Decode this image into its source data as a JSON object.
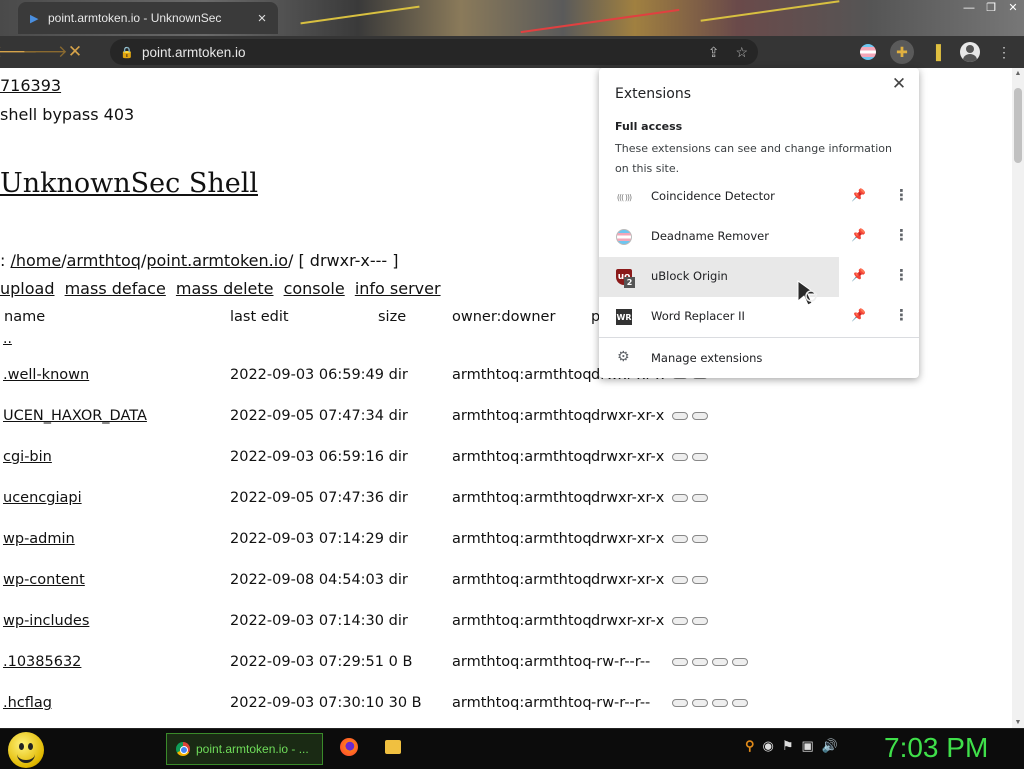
{
  "browser": {
    "tab_title": "point.armtoken.io - UnknownSec",
    "url": "point.armtoken.io",
    "accent_color": "#d6a34a"
  },
  "page": {
    "line1": "716393",
    "line2": "shell bypass 403",
    "title": "UnknownSec Shell",
    "path": {
      "prefix": ":",
      "seg1": "/home",
      "sep1": "/",
      "seg2": "armthtoq",
      "sep2": "/",
      "seg3": "point.armtoken.io",
      "sep3": "/",
      "perm": "[ drwxr-x--- ]"
    },
    "actions": [
      "upload",
      "mass deface",
      "mass delete",
      "console",
      "info server"
    ],
    "columns": {
      "name": "name",
      "last_edit": "last edit",
      "size": "size",
      "owner": "owner:downer",
      "perm": "p"
    },
    "updir": "..",
    "files": [
      {
        "name": ".well-known",
        "date": "2022-09-03 06:59:49",
        "size": "dir",
        "owner": "armthtoq:armthtoq",
        "perm": "drwxr-xr-x",
        "pills": 2
      },
      {
        "name": "UCEN_HAXOR_DATA",
        "date": "2022-09-05 07:47:34",
        "size": "dir",
        "owner": "armthtoq:armthtoq",
        "perm": "drwxr-xr-x",
        "pills": 2
      },
      {
        "name": "cgi-bin",
        "date": "2022-09-03 06:59:16",
        "size": "dir",
        "owner": "armthtoq:armthtoq",
        "perm": "drwxr-xr-x",
        "pills": 2
      },
      {
        "name": "ucencgiapi",
        "date": "2022-09-05 07:47:36",
        "size": "dir",
        "owner": "armthtoq:armthtoq",
        "perm": "drwxr-xr-x",
        "pills": 2
      },
      {
        "name": "wp-admin",
        "date": "2022-09-03 07:14:29",
        "size": "dir",
        "owner": "armthtoq:armthtoq",
        "perm": "drwxr-xr-x",
        "pills": 2
      },
      {
        "name": "wp-content",
        "date": "2022-09-08 04:54:03",
        "size": "dir",
        "owner": "armthtoq:armthtoq",
        "perm": "drwxr-xr-x",
        "pills": 2
      },
      {
        "name": "wp-includes",
        "date": "2022-09-03 07:14:30",
        "size": "dir",
        "owner": "armthtoq:armthtoq",
        "perm": "drwxr-xr-x",
        "pills": 2
      },
      {
        "name": ".10385632",
        "date": "2022-09-03 07:29:51",
        "size": "0 B",
        "owner": "armthtoq:armthtoq",
        "perm": "-rw-r--r--",
        "pills": 4
      },
      {
        "name": ".hcflag",
        "date": "2022-09-03 07:30:10",
        "size": "30 B",
        "owner": "armthtoq:armthtoq",
        "perm": "-rw-r--r--",
        "pills": 4
      }
    ]
  },
  "extensions_popup": {
    "title": "Extensions",
    "full_access_heading": "Full access",
    "full_access_desc": "These extensions can see and change information on this site.",
    "items": [
      {
        "name": "Coincidence Detector",
        "icon": "coincidence-icon",
        "pinned": false
      },
      {
        "name": "Deadname Remover",
        "icon": "trans-flag-icon",
        "pinned": true
      },
      {
        "name": "uBlock Origin",
        "icon": "ublock-icon",
        "badge": "2",
        "pinned": false
      },
      {
        "name": "Word Replacer II",
        "icon": "word-replacer-icon",
        "pinned": false
      }
    ],
    "manage_label": "Manage extensions",
    "pin_color_active": "#1a73e8"
  },
  "taskbar": {
    "task_label": "point.armtoken.io - ...",
    "clock": "7:03 PM",
    "clock_color": "#3fe04a"
  }
}
